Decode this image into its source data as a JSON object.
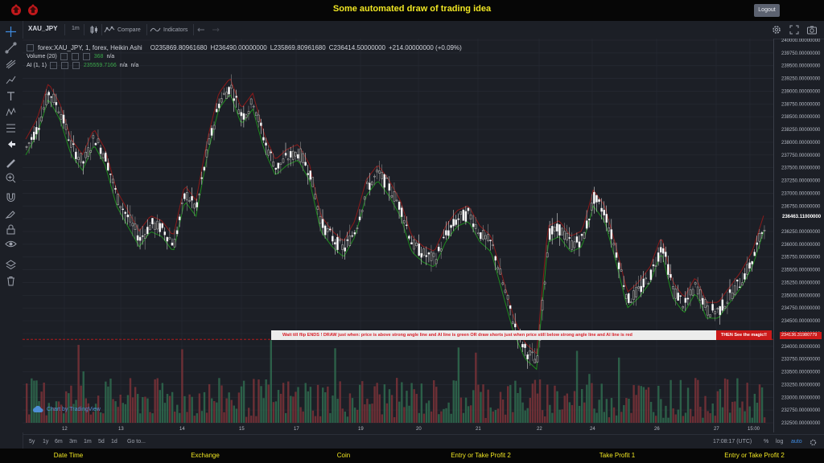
{
  "page": {
    "title": "Some automated draw of trading idea",
    "logout_label": "Logout",
    "logo_icons": [
      "red-logo-icon",
      "red-logo-icon"
    ]
  },
  "toolbar": {
    "symbol": "XAU_JPY",
    "interval": "1m",
    "compare_label": "Compare",
    "indicators_label": "Indicators"
  },
  "legend": {
    "main_title": "forex:XAU_JPY, 1, forex, Heikin Ashi",
    "open": "O235869.80961680",
    "high": "H236490.00000000",
    "low": "L235869.80961680",
    "close": "C236414.50000000",
    "change": "+214.00000000 (+0.09%)",
    "volume_label": "Volume (20)",
    "volume_value": "368",
    "volume_na": "n/a",
    "ai_label": "AI (1, 1)",
    "ai_value": "235559.7166",
    "ai_na1": "n/a",
    "ai_na2": "n/a"
  },
  "price_scale": [
    "240000.00000000",
    "239750.00000000",
    "239500.00000000",
    "239250.00000000",
    "239000.00000000",
    "238750.00000000",
    "238500.00000000",
    "238250.00000000",
    "238000.00000000",
    "237750.00000000",
    "237500.00000000",
    "237250.00000000",
    "237000.00000000",
    "236750.00000000",
    "236500.00000000",
    "236250.00000000",
    "236000.00000000",
    "235750.00000000",
    "235500.00000000",
    "235250.00000000",
    "235000.00000000",
    "234750.00000000",
    "234500.00000000",
    "234250.00000000",
    "234000.00000000",
    "233750.00000000",
    "233500.00000000",
    "233250.00000000",
    "233000.00000000",
    "232750.00000000",
    "232500.00000000"
  ],
  "last_price": "236463.11000000",
  "annotation": {
    "message": "Wait till flip ENDS !    DRAW just when:  price is above strong angle line and AI line is green          OR          draw shorts just when price still below strong angle line and AI line is red",
    "magic": "THEN See the magic!!",
    "price_tag": "234136.31980779"
  },
  "time_axis": [
    "12",
    "13",
    "14",
    "15",
    "17",
    "19",
    "20",
    "21",
    "22",
    "24",
    "26",
    "27",
    "15:00"
  ],
  "watermark": "Chart by TradingView",
  "bottom_bar": {
    "ranges": [
      "5y",
      "1y",
      "6m",
      "3m",
      "1m",
      "5d",
      "1d"
    ],
    "goto": "Go to...",
    "time": "17:08:17 (UTC)",
    "percent": "%",
    "log": "log",
    "auto": "auto"
  },
  "footer": [
    "Date Time",
    "Exchange",
    "Coin",
    "Entry or Take Profit 2",
    "Take Profit 1",
    "Entry or Take Profit 2"
  ],
  "colors": {
    "accent_yellow": "#f0e623",
    "up_candle": "#ffffff",
    "down_candle": "#2a2a2a",
    "ai_green": "#1e8c1e",
    "ai_red": "#8c1a1a",
    "volume_green": "#2f6b4f",
    "volume_red": "#7a3238",
    "banner_red": "#cc1a1a"
  },
  "chart_data": {
    "type": "candlestick",
    "ylim": [
      232500,
      240000
    ],
    "series": [
      {
        "name": "Heikin Ashi close",
        "values": [
          237900,
          238300,
          239000,
          238600,
          237900,
          237600,
          238100,
          237700,
          236900,
          236500,
          236100,
          236400,
          236300,
          236000,
          237000,
          236700,
          237900,
          238800,
          239100,
          238500,
          238800,
          238000,
          237500,
          237700,
          237800,
          237400,
          236400,
          236100,
          235900,
          236300,
          237100,
          237400,
          237100,
          236700,
          236000,
          235800,
          235700,
          236200,
          236500,
          236600,
          236200,
          236000,
          235200,
          234400,
          233900,
          233700,
          236200,
          236300,
          236000,
          236100,
          236900,
          236600,
          235800,
          234900,
          235100,
          235400,
          236000,
          235100,
          234800,
          235200,
          234700,
          234700,
          235000,
          235300,
          235700,
          236400
        ]
      }
    ]
  }
}
